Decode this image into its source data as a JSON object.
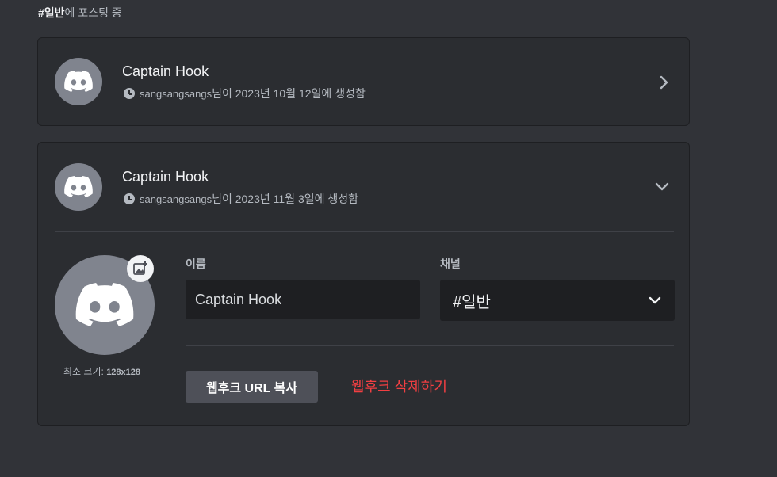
{
  "header": {
    "channel": "#일반",
    "suffix": "에 포스팅 중"
  },
  "webhooks": [
    {
      "name": "Captain Hook",
      "user": "sangsangsangs",
      "created": "님이 2023년 10월 12일에 생성함",
      "expanded": false
    },
    {
      "name": "Captain Hook",
      "user": "sangsangsangs",
      "created": "님이 2023년 11월 3일에 생성함",
      "expanded": true
    }
  ],
  "editor": {
    "min_size_label": "최소 크기:",
    "min_size_value": "128x128",
    "name_label": "이름",
    "name_value": "Captain Hook",
    "channel_label": "채널",
    "channel_value": "#일반",
    "copy_url_button": "웹후크 URL 복사",
    "delete_link": "웹후크 삭제하기"
  },
  "icons": {
    "avatar": "discord-logo-icon",
    "time": "clock-icon",
    "collapsed": "chevron-right-icon",
    "expanded": "chevron-down-icon",
    "upload": "add-image-icon",
    "dropdown": "chevron-down-icon"
  },
  "colors": {
    "background": "#313338",
    "card": "#2b2d31",
    "input": "#1e1f22",
    "avatar": "#80848e",
    "danger": "#f23f42",
    "button": "#4e5058"
  }
}
